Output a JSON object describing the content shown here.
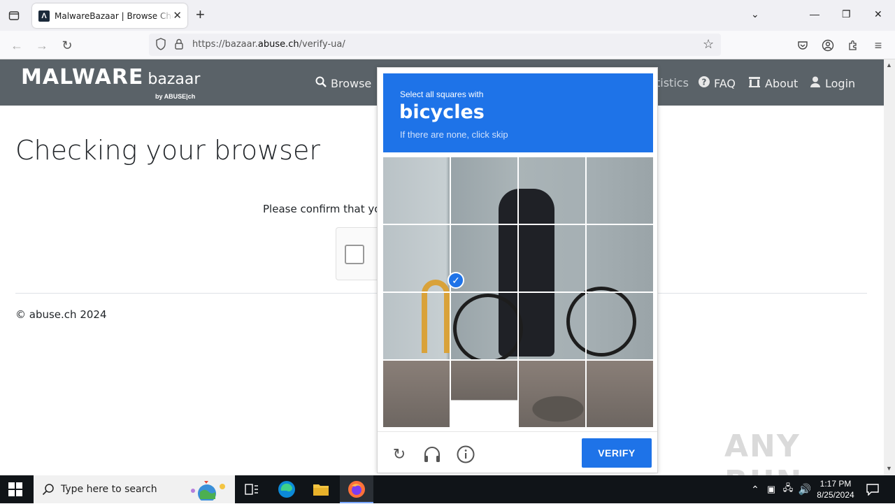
{
  "browser": {
    "tab_title": "MalwareBazaar | Browse Checkin",
    "tab_favicon": "Λ",
    "url_prefix": "https://bazaar.",
    "url_domain": "abuse.ch",
    "url_path": "/verify-ua/"
  },
  "site": {
    "logo_main": "MALWARE",
    "logo_sub": "bazaar",
    "logo_by": "by ABUSE|ch",
    "nav": [
      {
        "label": "Browse",
        "icon": "search-icon"
      },
      {
        "label": "tistics",
        "icon": "chart-icon"
      },
      {
        "label": "FAQ",
        "icon": "question-circle-icon"
      },
      {
        "label": "About",
        "icon": "building-icon"
      },
      {
        "label": "Login",
        "icon": "user-icon"
      }
    ],
    "heading": "Checking your browser",
    "confirm_text": "Please confirm that you",
    "footer": "© abuse.ch 2024"
  },
  "captcha": {
    "prompt": "Select all squares with",
    "object": "bicycles",
    "skip_hint": "If there are none, click skip",
    "selected_cells": [
      13
    ],
    "verify_label": "VERIFY"
  },
  "watermark": "ANY RUN",
  "taskbar": {
    "search_placeholder": "Type here to search",
    "time": "1:17 PM",
    "date": "8/25/2024"
  }
}
